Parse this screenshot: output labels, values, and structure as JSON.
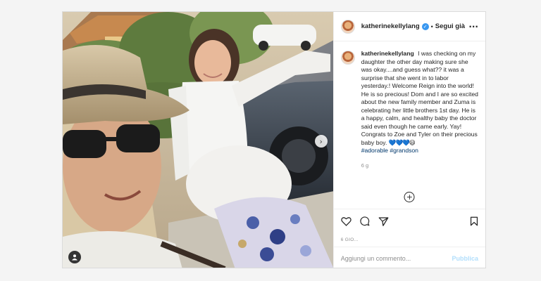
{
  "post": {
    "username": "katherinekellylang",
    "follow_status": "Segui già",
    "more_icon": "more-options-icon",
    "caption_text": "I was checking on my daughter the other day making sure she was okay....and guess what?? it was a surprise that she went in to labor yesterday.! Welcome Reign into the world! He is so precious! Dom and I are so excited about the new family member and Zuma is celebrating her little brothers 1st day. He is a happy, calm, and healthy baby the doctor said even though he came early. Yay! Congrats to Zoe and Tyler on their precious baby boy.",
    "caption_emojis": "💙💙💙",
    "caption_smile": "😃",
    "hashtags": "#adorable #grandson",
    "time_ago": "6 g",
    "date_line": "6 GIO...",
    "comment_placeholder": "Aggiungi un commento...",
    "publish_label": "Pubblica"
  },
  "colors": {
    "verified": "#3897f0",
    "hashtag": "#00376b",
    "publish_disabled": "#b2dffc"
  },
  "icons": {
    "like": "heart-icon",
    "comment": "comment-icon",
    "share": "paper-plane-icon",
    "save": "bookmark-icon",
    "next": "chevron-right-icon",
    "tags": "user-tag-icon",
    "load_more": "plus-circle-icon"
  }
}
